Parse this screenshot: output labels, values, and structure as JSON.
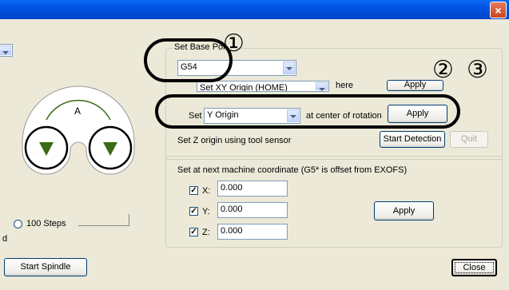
{
  "window": {
    "close_glyph": "×"
  },
  "base_point": {
    "group_label": "Set Base Poi",
    "combo_value": "G54",
    "row2_combo": "Set XY Origin (HOME)",
    "row2_suffix": "here",
    "row2_apply": "Apply"
  },
  "rotation": {
    "set_label": "Set",
    "combo_value": "Y Origin",
    "suffix": "at center of rotation",
    "apply": "Apply"
  },
  "z_origin": {
    "label": "Set Z origin using tool sensor",
    "start_detection": "Start Detection",
    "quit": "Quit"
  },
  "machine_coord": {
    "label": "Set at next machine coordinate  (G5* is offset from EXOFS)",
    "x_label": "X:",
    "x_value": "0.000",
    "y_label": "Y:",
    "y_value": "0.000",
    "z_label": "Z:",
    "z_value": "0.000",
    "apply": "Apply"
  },
  "left": {
    "jog_label": "A",
    "steps_label": "100 Steps",
    "partial_label": "d",
    "start_spindle": "Start Spindle"
  },
  "footer": {
    "close": "Close"
  },
  "annotations": {
    "n1": "①",
    "n2": "②",
    "n3": "③"
  },
  "colors": {
    "titlebar": "#0054E3",
    "window_bg": "#ECE9D8",
    "jog_green": "#3C6A12"
  }
}
